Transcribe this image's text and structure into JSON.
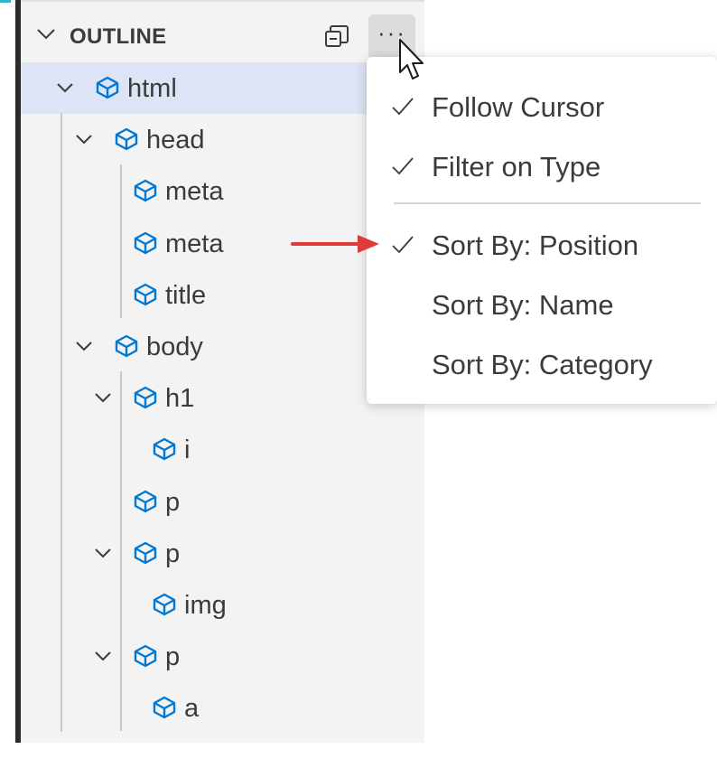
{
  "outline": {
    "title": "OUTLINE",
    "collapse_icon": "collapse-all-icon",
    "more_icon": "ellipsis-icon",
    "more_label": "···",
    "accent_color": "#0078d4",
    "items": [
      {
        "label": "html",
        "depth": 0,
        "expandable": true,
        "selected": true
      },
      {
        "label": "head",
        "depth": 1,
        "expandable": true
      },
      {
        "label": "meta",
        "depth": 2,
        "expandable": false
      },
      {
        "label": "meta",
        "depth": 2,
        "expandable": false
      },
      {
        "label": "title",
        "depth": 2,
        "expandable": false
      },
      {
        "label": "body",
        "depth": 1,
        "expandable": true
      },
      {
        "label": "h1",
        "depth": 2,
        "expandable": true
      },
      {
        "label": "i",
        "depth": 3,
        "expandable": false
      },
      {
        "label": "p",
        "depth": 2,
        "expandable": false
      },
      {
        "label": "p",
        "depth": 2,
        "expandable": true
      },
      {
        "label": "img",
        "depth": 3,
        "expandable": false
      },
      {
        "label": "p",
        "depth": 2,
        "expandable": true
      },
      {
        "label": "a",
        "depth": 3,
        "expandable": false
      }
    ]
  },
  "menu": {
    "items": [
      {
        "label": "Follow Cursor",
        "checked": true
      },
      {
        "label": "Filter on Type",
        "checked": true
      },
      {
        "label": "Sort By: Position",
        "checked": true
      },
      {
        "label": "Sort By: Name",
        "checked": false
      },
      {
        "label": "Sort By: Category",
        "checked": false
      }
    ]
  },
  "annotation": {
    "arrow_color": "#e03a3a"
  }
}
